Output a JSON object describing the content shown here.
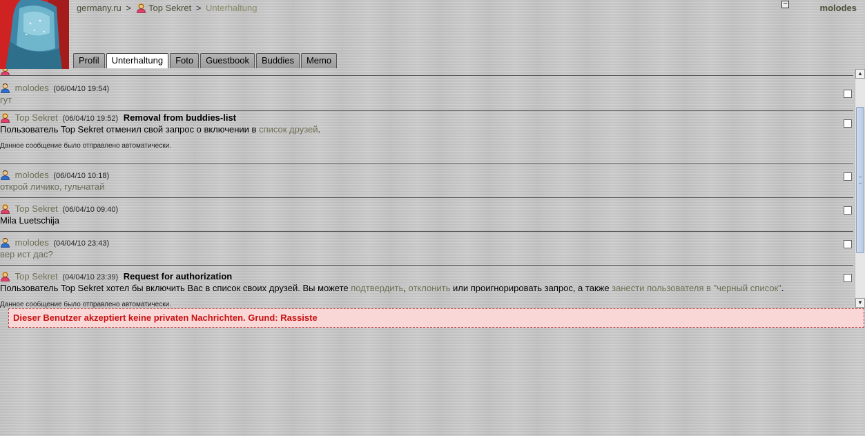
{
  "breadcrumb": {
    "site": "germany.ru",
    "separator": ">",
    "user": "Top Sekret",
    "section": "Unterhaltung"
  },
  "header": {
    "current_user": "molodes",
    "collapse_symbol": "−"
  },
  "tabs": [
    {
      "label": "Profil"
    },
    {
      "label": "Unterhaltung",
      "active": true
    },
    {
      "label": "Foto"
    },
    {
      "label": "Guestbook"
    },
    {
      "label": "Buddies"
    },
    {
      "label": "Memo"
    }
  ],
  "messages": [
    {
      "author": "molodes",
      "gender": "male",
      "timestamp": "(06/04/10 19:54)",
      "text": "гут"
    },
    {
      "author": "Top Sekret",
      "gender": "female",
      "timestamp": "(06/04/10 19:52)",
      "subject": "Removal from buddies-list",
      "text_pre": "Пользователь Top Sekret отменил свой запрос о включении в ",
      "link": "список друзей",
      "text_post": ".",
      "note": "Данное сообщение было отправлено автоматически."
    },
    {
      "author": "molodes",
      "gender": "male",
      "timestamp": "(06/04/10 10:18)",
      "text": "открой личико, гульчатай"
    },
    {
      "author": "Top Sekret",
      "gender": "female",
      "timestamp": "(06/04/10 09:40)",
      "text": "Mila Luetschija"
    },
    {
      "author": "molodes",
      "gender": "male",
      "timestamp": "(04/04/10 23:43)",
      "text": "вер ист дас?"
    },
    {
      "author": "Top Sekret",
      "gender": "female",
      "timestamp": "(04/04/10 23:39)",
      "subject": "Request for authorization",
      "text_pre": "Пользователь Top Sekret хотел бы включить Вас в список своих друзей. Вы можете ",
      "link_confirm": "подтвердить",
      "comma": ", ",
      "link_decline": "отклонить",
      "text_mid": " или проигнорировать запрос, а также ",
      "link_blacklist": "занести пользователя в \"черный список\"",
      "text_post": ".",
      "note": "Данное сообщение было отправлено автоматически."
    }
  ],
  "notice": "Dieser Benutzer akzeptiert keine privaten Nachrichten. Grund: Rassiste",
  "colors": {
    "link": "#6f6f55",
    "notice_bg": "#f9d7d7",
    "notice_text": "#c81010",
    "male_icon": "#2f6fd0",
    "female_icon": "#e0406a"
  }
}
